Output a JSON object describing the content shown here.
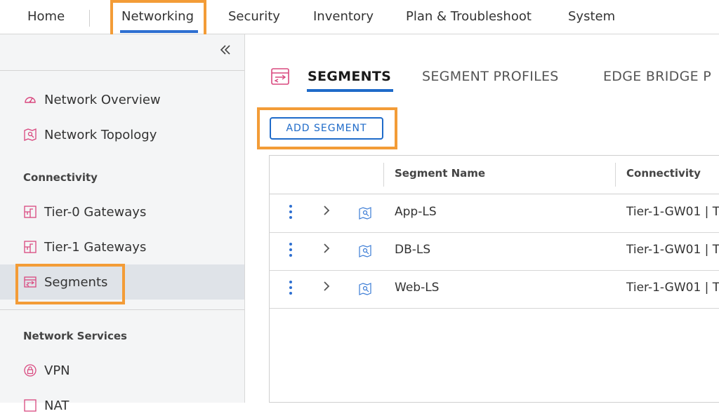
{
  "topnav": {
    "items": [
      "Home",
      "Networking",
      "Security",
      "Inventory",
      "Plan & Troubleshoot",
      "System"
    ],
    "active": "Networking"
  },
  "sidebar": {
    "collapse_icon": "double-chevron-left-icon",
    "items_top": [
      {
        "label": "Network Overview",
        "icon": "gauge-icon"
      },
      {
        "label": "Network Topology",
        "icon": "topology-map-icon"
      }
    ],
    "section_connectivity": "Connectivity",
    "connectivity_items": [
      {
        "label": "Tier-0 Gateways",
        "icon": "gateway-icon"
      },
      {
        "label": "Tier-1 Gateways",
        "icon": "gateway-icon"
      },
      {
        "label": "Segments",
        "icon": "segment-icon",
        "active": true
      }
    ],
    "section_services": "Network Services",
    "services_items": [
      {
        "label": "VPN",
        "icon": "lock-icon"
      },
      {
        "label": "NAT",
        "icon": "nat-icon"
      }
    ]
  },
  "main": {
    "tabs": [
      "SEGMENTS",
      "SEGMENT PROFILES",
      "EDGE BRIDGE P"
    ],
    "active_tab": "SEGMENTS",
    "add_button": "ADD SEGMENT",
    "table": {
      "headers": [
        "Segment Name",
        "Connectivity"
      ],
      "rows": [
        {
          "name": "App-LS",
          "connectivity": "Tier-1-GW01 | T"
        },
        {
          "name": "DB-LS",
          "connectivity": "Tier-1-GW01 | T"
        },
        {
          "name": "Web-LS",
          "connectivity": "Tier-1-GW01 | T"
        }
      ]
    }
  },
  "colors": {
    "accent_blue": "#1f6bc9",
    "highlight_orange": "#f39c37",
    "icon_pink": "#d9487f",
    "sidebar_bg": "#f4f5f6"
  }
}
